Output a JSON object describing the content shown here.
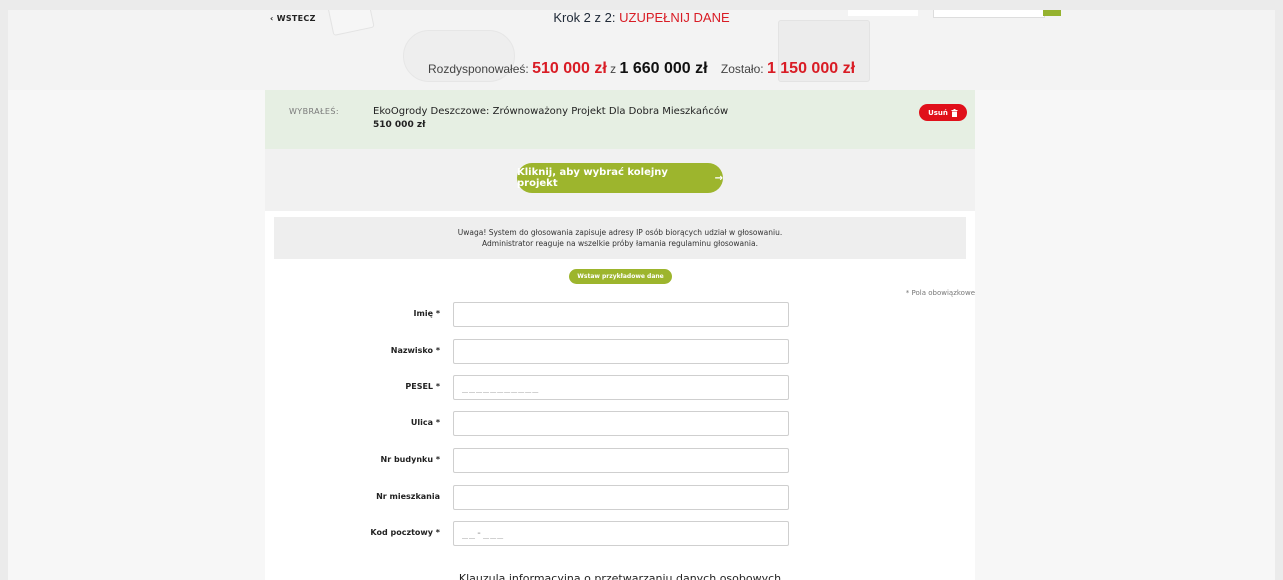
{
  "header": {
    "back_label": "WSTECZ",
    "step_prefix": "Krok 2 z 2:",
    "step_title": "UZUPEŁNIJ DANE",
    "allocated_label": "Rozdysponowałeś:",
    "allocated_value": "510 000 zł",
    "of_label": "z",
    "total_value": "1 660 000 zł",
    "remaining_label": "Zostało:",
    "remaining_value": "1 150 000 zł"
  },
  "selected": {
    "label": "WYBRAŁEŚ:",
    "project_title": "EkoOgrody Deszczowe: Zrównoważony Projekt Dla Dobra Mieszkańców",
    "price": "510 000 zł",
    "remove_label": "Usuń"
  },
  "next": {
    "button_label": "Kliknij, aby wybrać kolejny projekt",
    "arrow": "→"
  },
  "warning": {
    "line1": "Uwaga! System do głosowania zapisuje adresy IP osób biorących udział w głosowaniu.",
    "line2": "Administrator reaguje na wszelkie próby łamania regulaminu głosowania."
  },
  "form": {
    "sample_button": "Wstaw przykładowe dane",
    "required_note": "* Pola obowiązkowe",
    "fields": [
      {
        "label": "Imię *",
        "value": "",
        "placeholder": ""
      },
      {
        "label": "Nazwisko *",
        "value": "",
        "placeholder": ""
      },
      {
        "label": "PESEL *",
        "value": "",
        "placeholder": "___________"
      },
      {
        "label": "Ulica *",
        "value": "",
        "placeholder": ""
      },
      {
        "label": "Nr budynku *",
        "value": "",
        "placeholder": ""
      },
      {
        "label": "Nr mieszkania",
        "value": "",
        "placeholder": ""
      },
      {
        "label": "Kod pocztowy *",
        "value": "",
        "placeholder": "__-___"
      }
    ],
    "clause_title": "Klauzula informacyjna o przetwarzaniu danych osobowych"
  },
  "icons": {
    "back": "chevron-left-icon",
    "remove": "trash-icon",
    "next": "arrow-right-icon"
  },
  "colors": {
    "accent_green": "#9db52d",
    "accent_red": "#d91c25",
    "selected_bg": "#e6efe3"
  }
}
